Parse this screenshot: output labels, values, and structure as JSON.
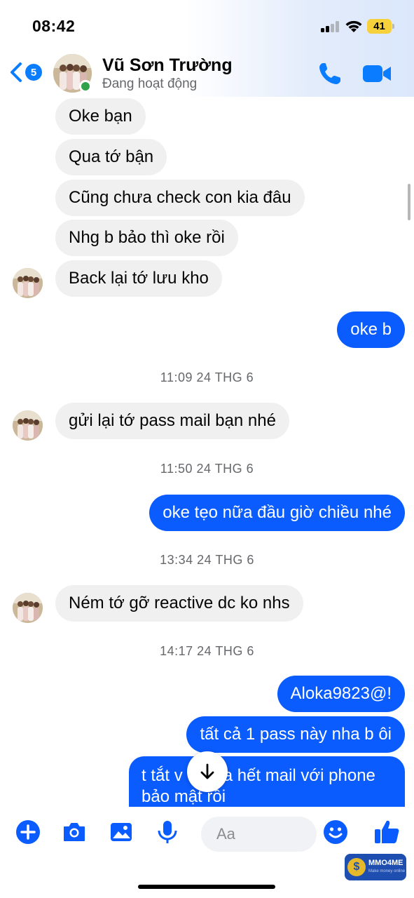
{
  "status_bar": {
    "time": "08:42",
    "battery": "41"
  },
  "header": {
    "back_count": "5",
    "contact_name": "Vũ Sơn Trường",
    "contact_status": "Đang hoạt động",
    "icons": [
      "back-chevron-icon",
      "phone-icon",
      "video-camera-icon"
    ]
  },
  "messages": [
    {
      "direction": "in",
      "text": "Oke bạn"
    },
    {
      "direction": "in",
      "text": "Qua tớ bận"
    },
    {
      "direction": "in",
      "text": "Cũng chưa check con kia đâu"
    },
    {
      "direction": "in",
      "text": "Nhg b bảo thì oke rồi"
    },
    {
      "direction": "in",
      "text": "Back lại tớ lưu kho"
    },
    {
      "direction": "out",
      "text": "oke b"
    },
    {
      "timestamp": "11:09 24 THG 6"
    },
    {
      "direction": "in",
      "text": "gửi lại tớ pass mail bạn nhé"
    },
    {
      "timestamp": "11:50 24 THG 6"
    },
    {
      "direction": "out",
      "text": "oke tẹo nữa đầu giờ chiều nhé"
    },
    {
      "timestamp": "13:34 24 THG 6"
    },
    {
      "direction": "in",
      "text": "Ném tớ gỡ reactive dc ko nhs"
    },
    {
      "timestamp": "14:17 24 THG 6"
    },
    {
      "direction": "out",
      "text": "Aloka9823@!"
    },
    {
      "direction": "out",
      "text": "tất cả 1 pass này nha b ôi"
    },
    {
      "direction": "out",
      "text_line1": "t tắt v",
      "text_line1_end": "a hết mail với phone",
      "text_line2": "bảo mật rồi"
    }
  ],
  "composer": {
    "placeholder": "Aa",
    "icons": [
      "plus-icon",
      "camera-icon",
      "image-icon",
      "microphone-icon",
      "emoji-icon",
      "thumbs-up-icon"
    ]
  },
  "watermark": {
    "brand": "MMO4ME",
    "tagline": "Make money online"
  },
  "colors": {
    "accent": "#0a5cff",
    "incoming_bubble": "#f0f0f0",
    "online": "#31a24c"
  }
}
